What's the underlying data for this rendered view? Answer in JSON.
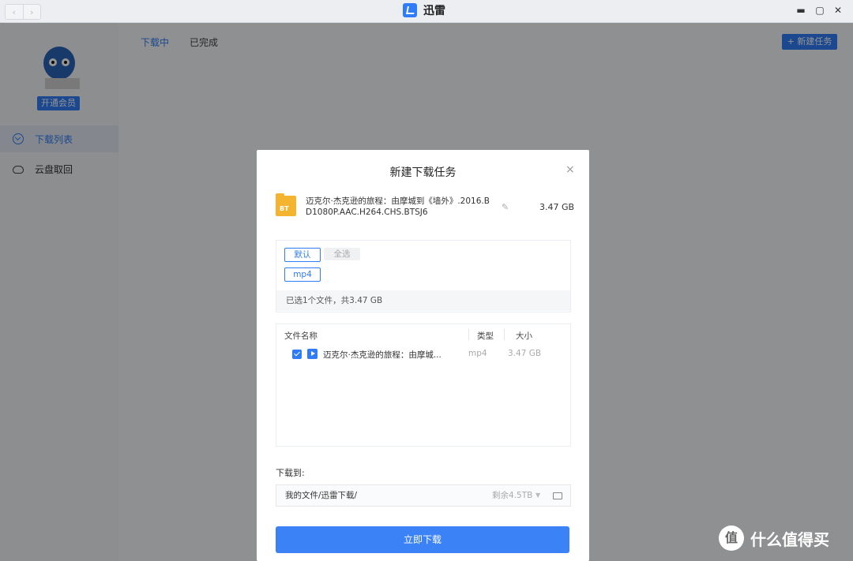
{
  "window": {
    "title": "迅雷",
    "controls": {
      "minimize": "▬",
      "maximize": "▢",
      "close": "✕"
    }
  },
  "sidebar": {
    "vip_button": "开通会员",
    "items": [
      {
        "label": "下载列表",
        "icon": "download-circle-icon",
        "active": true
      },
      {
        "label": "云盘取回",
        "icon": "cloud-icon",
        "active": false
      }
    ]
  },
  "main": {
    "tabs": [
      {
        "label": "下载中",
        "active": true
      },
      {
        "label": "已完成",
        "active": false
      }
    ],
    "new_task_button": "+ 新建任务"
  },
  "dialog": {
    "title": "新建下载任务",
    "close_icon": "×",
    "torrent": {
      "icon_label": "BT",
      "name": "迈克尔·杰克逊的旅程：由摩城到《墙外》.2016.BD1080P.AAC.H264.CHS.BTSJ6",
      "size": "3.47 GB"
    },
    "filters": {
      "default_chip": "默认",
      "select_all_chip": "全选",
      "ext_chip": "mp4"
    },
    "selection_summary": "已选1个文件，共3.47 GB",
    "table": {
      "headers": {
        "name": "文件名称",
        "type": "类型",
        "size": "大小"
      },
      "rows": [
        {
          "checked": true,
          "name": "迈克尔·杰克逊的旅程：由摩城...",
          "type": "mp4",
          "size": "3.47 GB"
        }
      ]
    },
    "save_to_label": "下载到:",
    "save_path": "我的文件/迅雷下载/",
    "remaining_space": "剩余4.5TB",
    "download_button": "立即下载"
  },
  "watermark": {
    "icon": "值",
    "text": "什么值得买"
  },
  "colors": {
    "accent": "#2f7cf6",
    "folder": "#f5b430"
  }
}
